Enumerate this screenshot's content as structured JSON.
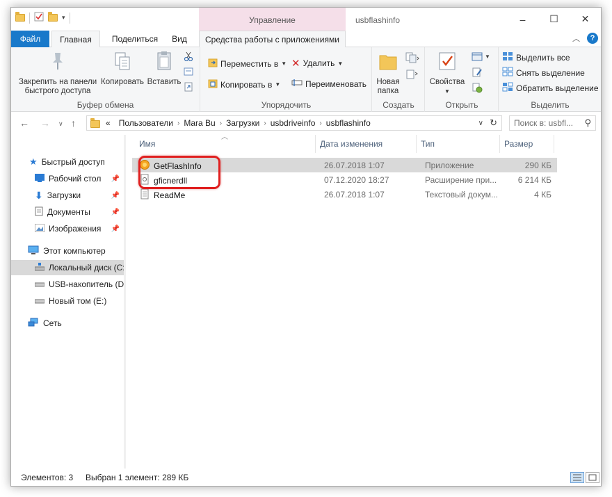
{
  "titlebar": {
    "manage_label": "Управление",
    "window_title": "usbflashinfo",
    "minimize": "–",
    "maximize": "☐",
    "close": "✕"
  },
  "tabs": {
    "file": "Файл",
    "home": "Главная",
    "share": "Поделиться",
    "view": "Вид",
    "app_tools": "Средства работы с приложениями"
  },
  "ribbon": {
    "clipboard": {
      "pin_label": "Закрепить на панели быстрого доступа",
      "copy_label": "Копировать",
      "paste_label": "Вставить",
      "group_label": "Буфер обмена"
    },
    "organize": {
      "move_to": "Переместить в",
      "copy_to": "Копировать в",
      "delete": "Удалить",
      "rename": "Переименовать",
      "group_label": "Упорядочить"
    },
    "new": {
      "new_folder": "Новая папка",
      "group_label": "Создать"
    },
    "open": {
      "properties": "Свойства",
      "group_label": "Открыть"
    },
    "select": {
      "select_all": "Выделить все",
      "select_none": "Снять выделение",
      "invert": "Обратить выделение",
      "group_label": "Выделить"
    }
  },
  "address": {
    "prefix": "«",
    "crumbs": [
      "Пользователи",
      "Mara Bu",
      "Загрузки",
      "usbdriveinfo",
      "usbflashinfo"
    ],
    "search_placeholder": "Поиск в: usbfl..."
  },
  "nav": {
    "quick_access": "Быстрый доступ",
    "desktop": "Рабочий стол",
    "downloads": "Загрузки",
    "documents": "Документы",
    "pictures": "Изображения",
    "this_pc": "Этот компьютер",
    "local_disk": "Локальный диск (C:",
    "usb_drive": "USB-накопитель (D:",
    "new_volume": "Новый том (E:)",
    "network": "Сеть"
  },
  "columns": {
    "name": "Имя",
    "date": "Дата изменения",
    "type": "Тип",
    "size": "Размер"
  },
  "files": [
    {
      "name": "GetFlashInfo",
      "date": "26.07.2018 1:07",
      "type": "Приложение",
      "size": "290 КБ",
      "selected": true,
      "icon": "app-gear-icon"
    },
    {
      "name": "gficnerdll",
      "date": "07.12.2020 18:27",
      "type": "Расширение при...",
      "size": "6 214 КБ",
      "selected": false,
      "icon": "dll-file-icon"
    },
    {
      "name": "ReadMe",
      "date": "26.07.2018 1:07",
      "type": "Текстовый докум...",
      "size": "4 КБ",
      "selected": false,
      "icon": "text-file-icon"
    }
  ],
  "status": {
    "items": "Элементов: 3",
    "selected": "Выбран 1 элемент: 289 КБ"
  },
  "colors": {
    "accent": "#1979ca",
    "manage_tab": "#f5dfe9",
    "highlight": "#e02020"
  }
}
